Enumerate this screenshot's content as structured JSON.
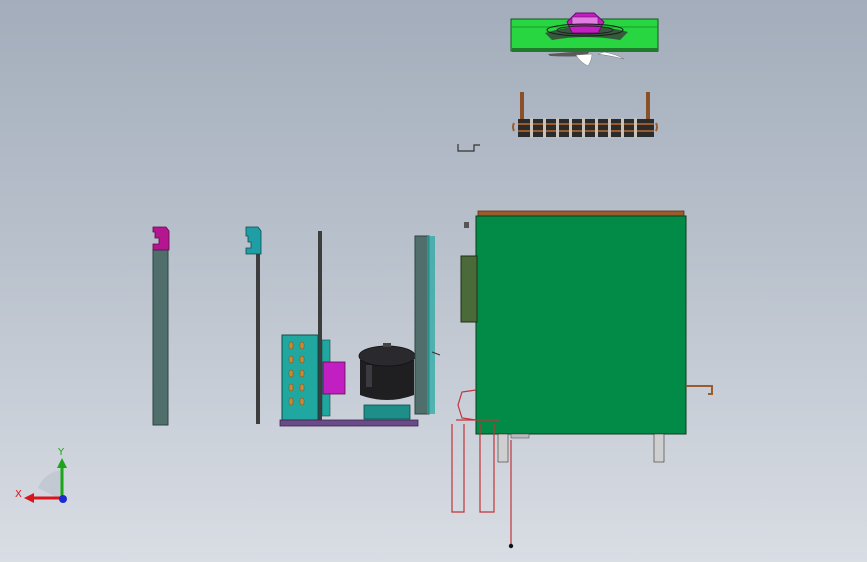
{
  "view": {
    "background_top": "#a3adbb",
    "background_bottom": "#d9dde4"
  },
  "triad": {
    "x_label": "X",
    "y_label": "Y",
    "x_color": "#d8141c",
    "y_color": "#1aa51a",
    "z_color": "#1c2ad0"
  },
  "colors": {
    "housing_green": "#028b46",
    "fan_shroud_green": "#27d641",
    "fan_motor_magenta": "#c21fc3",
    "condenser_teal": "#1fa7a0",
    "compressor_black": "#1f1f22",
    "tube_red": "#c0343a",
    "coil_copper": "#9a5b2d",
    "bracket_grey": "#4f6e6c",
    "base_purple": "#6a4a87"
  },
  "parts": [
    "top-fan-assembly",
    "evaporator-coil",
    "small-clip",
    "left-bracket-post",
    "second-bracket-post",
    "condenser-unit",
    "compressor",
    "side-panel",
    "main-housing",
    "capillary-tubes"
  ]
}
